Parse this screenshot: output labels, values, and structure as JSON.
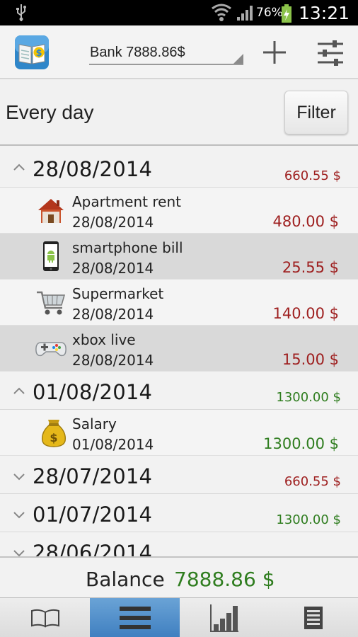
{
  "status_bar": {
    "battery_percent": "76%",
    "time": "13:21",
    "icons": [
      "usb-icon",
      "wifi-icon",
      "signal-icon",
      "battery-charging-icon"
    ]
  },
  "action_bar": {
    "account_label": "Bank 7888.86$",
    "icons": [
      "app-logo-icon",
      "add-icon",
      "settings-sliders-icon"
    ]
  },
  "filter_row": {
    "period": "Every day",
    "filter_label": "Filter"
  },
  "groups": [
    {
      "date": "28/08/2014",
      "amount": "660.55 $",
      "type": "expense",
      "expanded": true,
      "transactions": [
        {
          "name": "Apartment rent",
          "date": "28/08/2014",
          "amount": "480.00 $",
          "icon": "house-icon"
        },
        {
          "name": "smartphone bill",
          "date": "28/08/2014",
          "amount": "25.55 $",
          "icon": "smartphone-icon"
        },
        {
          "name": "Supermarket",
          "date": "28/08/2014",
          "amount": "140.00 $",
          "icon": "shopping-cart-icon"
        },
        {
          "name": "xbox live",
          "date": "28/08/2014",
          "amount": "15.00 $",
          "icon": "gamepad-icon"
        }
      ]
    },
    {
      "date": "01/08/2014",
      "amount": "1300.00 $",
      "type": "income",
      "expanded": true,
      "transactions": [
        {
          "name": "Salary",
          "date": "01/08/2014",
          "amount": "1300.00 $",
          "icon": "money-bag-icon"
        }
      ]
    },
    {
      "date": "28/07/2014",
      "amount": "660.55 $",
      "type": "expense",
      "expanded": false
    },
    {
      "date": "01/07/2014",
      "amount": "1300.00 $",
      "type": "income",
      "expanded": false
    },
    {
      "date": "28/06/2014",
      "amount": "",
      "type": "expense",
      "expanded": false
    }
  ],
  "balance": {
    "label": "Balance",
    "value": "7888.86 $"
  },
  "bottom_tabs": [
    {
      "icon": "book-icon",
      "active": false
    },
    {
      "icon": "list-icon",
      "active": true
    },
    {
      "icon": "bar-chart-icon",
      "active": false
    },
    {
      "icon": "report-icon",
      "active": false
    }
  ],
  "colors": {
    "expense": "#9e1f1f",
    "income": "#2f7d1f",
    "active_tab": "#4a8ac8"
  }
}
